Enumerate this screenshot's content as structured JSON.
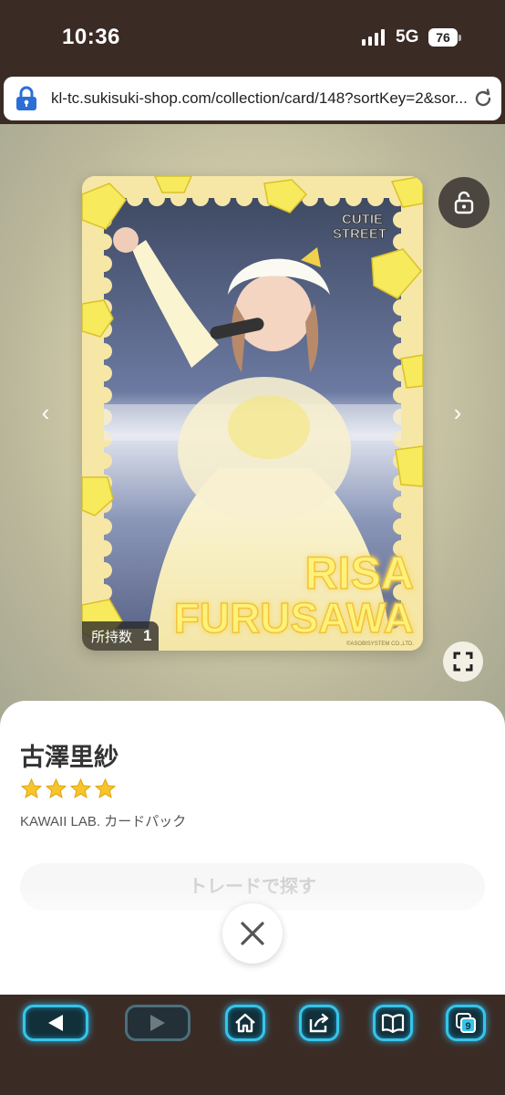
{
  "status_bar": {
    "time": "10:36",
    "network": "5G",
    "battery": "76"
  },
  "browser": {
    "url": "kl-tc.sukisuki-shop.com/collection/card/148?sortKey=2&sor..."
  },
  "card": {
    "brand_logo_line1": "CUTIE",
    "brand_logo_line2": "STREET",
    "name_line1": "RISA",
    "name_line2": "FURUSAWA",
    "copyright": "©ASOBISYSTEM CO.,LTD.",
    "owned_label": "所持数",
    "owned_count": "1"
  },
  "detail": {
    "member_name": "古澤里紗",
    "rarity_stars": 4,
    "pack_name": "KAWAII LAB. カードパック",
    "trade_button_label": "トレードで探す"
  },
  "toolbar": {
    "tabs_count": "9"
  },
  "colors": {
    "accent": "#36c4ea",
    "frame": "#f6e7a6",
    "name_glow": "#fff27a"
  }
}
